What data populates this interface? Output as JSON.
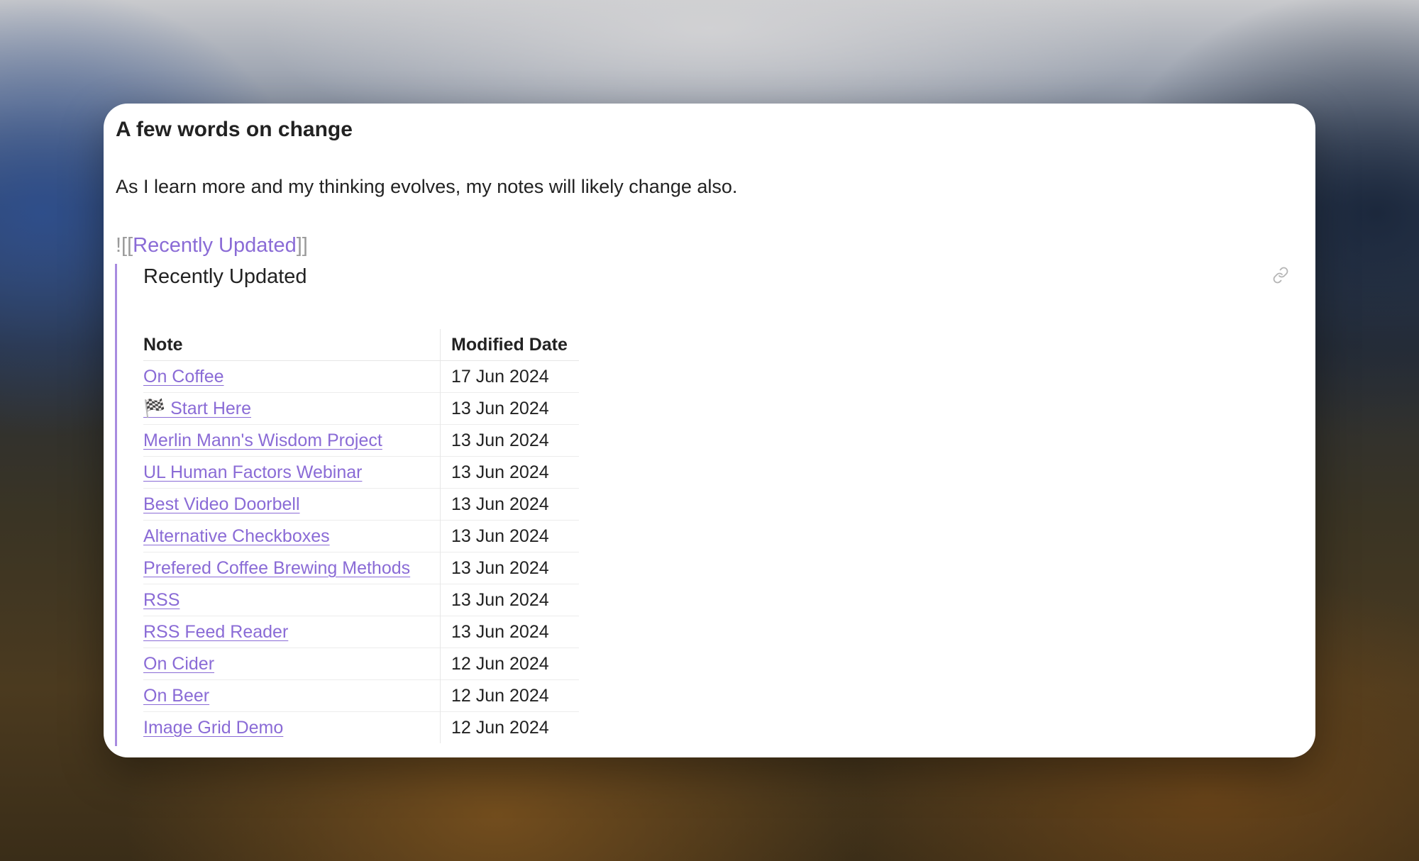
{
  "note": {
    "heading": "A few words on change",
    "paragraph": "As I learn more and my thinking evolves, my notes will likely change also."
  },
  "embed": {
    "prefix": "![[",
    "link": "Recently Updated",
    "suffix": "]]",
    "title": "Recently Updated",
    "link_icon": "link-icon"
  },
  "table": {
    "headers": [
      "Note",
      "Modified Date"
    ],
    "rows": [
      {
        "note": "On Coffee",
        "date": "17 Jun 2024"
      },
      {
        "note": "🏁 Start Here",
        "date": "13 Jun 2024"
      },
      {
        "note": "Merlin Mann's Wisdom Project",
        "date": "13 Jun 2024"
      },
      {
        "note": "UL Human Factors Webinar",
        "date": "13 Jun 2024"
      },
      {
        "note": "Best Video Doorbell",
        "date": "13 Jun 2024"
      },
      {
        "note": "Alternative Checkboxes",
        "date": "13 Jun 2024"
      },
      {
        "note": "Prefered Coffee Brewing Methods",
        "date": "13 Jun 2024"
      },
      {
        "note": "RSS",
        "date": "13 Jun 2024"
      },
      {
        "note": "RSS Feed Reader",
        "date": "13 Jun 2024"
      },
      {
        "note": "On Cider",
        "date": "12 Jun 2024"
      },
      {
        "note": "On Beer",
        "date": "12 Jun 2024"
      },
      {
        "note": "Image Grid Demo",
        "date": "12 Jun 2024"
      }
    ]
  },
  "colors": {
    "link": "#8a6bd6",
    "embed_border": "#a88be0",
    "text": "#222222",
    "syntax": "#9a9a9a"
  }
}
